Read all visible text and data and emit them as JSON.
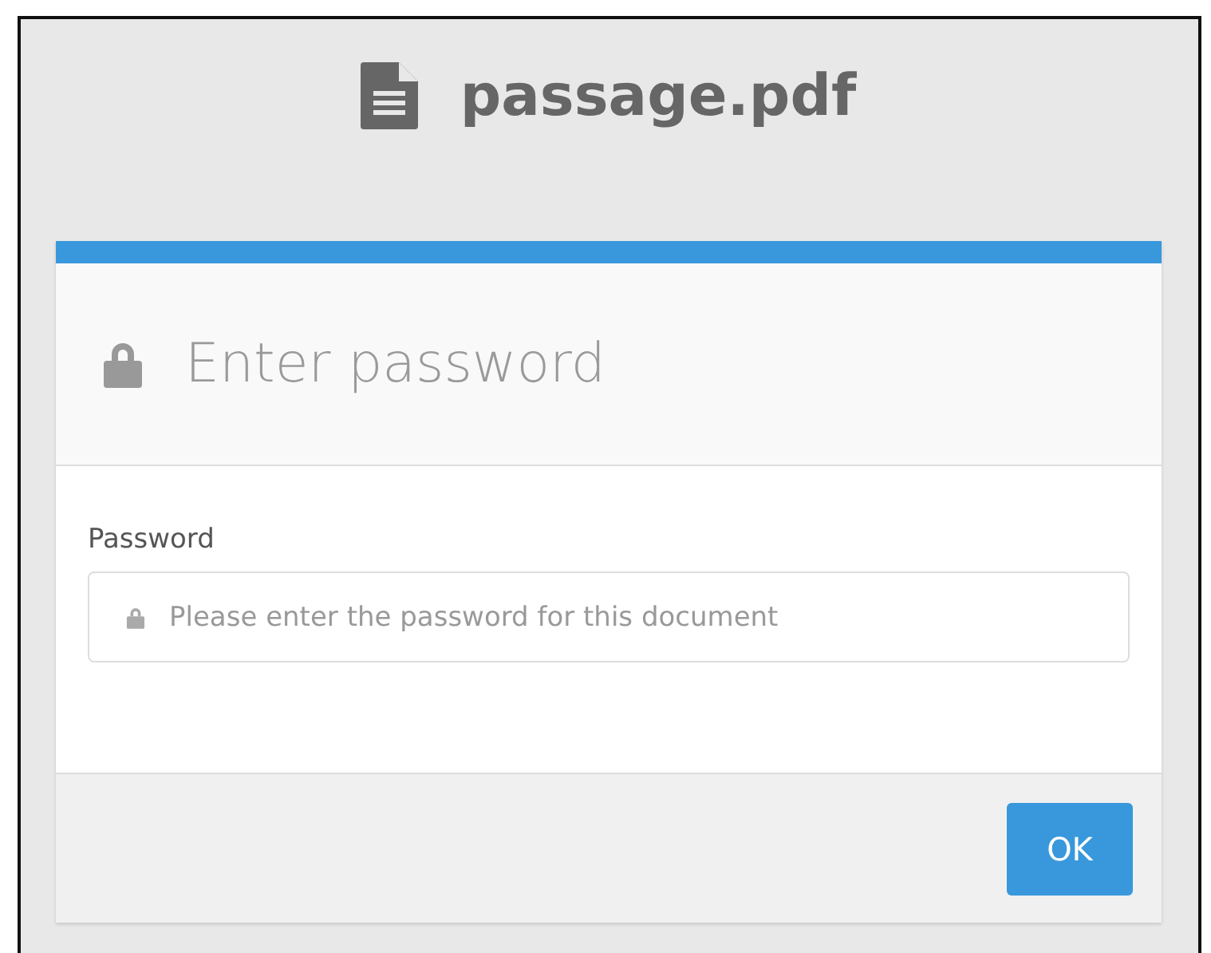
{
  "file": {
    "title": "passage.pdf"
  },
  "dialog": {
    "title": "Enter password",
    "field": {
      "label": "Password",
      "placeholder": "Please enter the password for this document"
    },
    "buttons": [
      "OK"
    ]
  }
}
